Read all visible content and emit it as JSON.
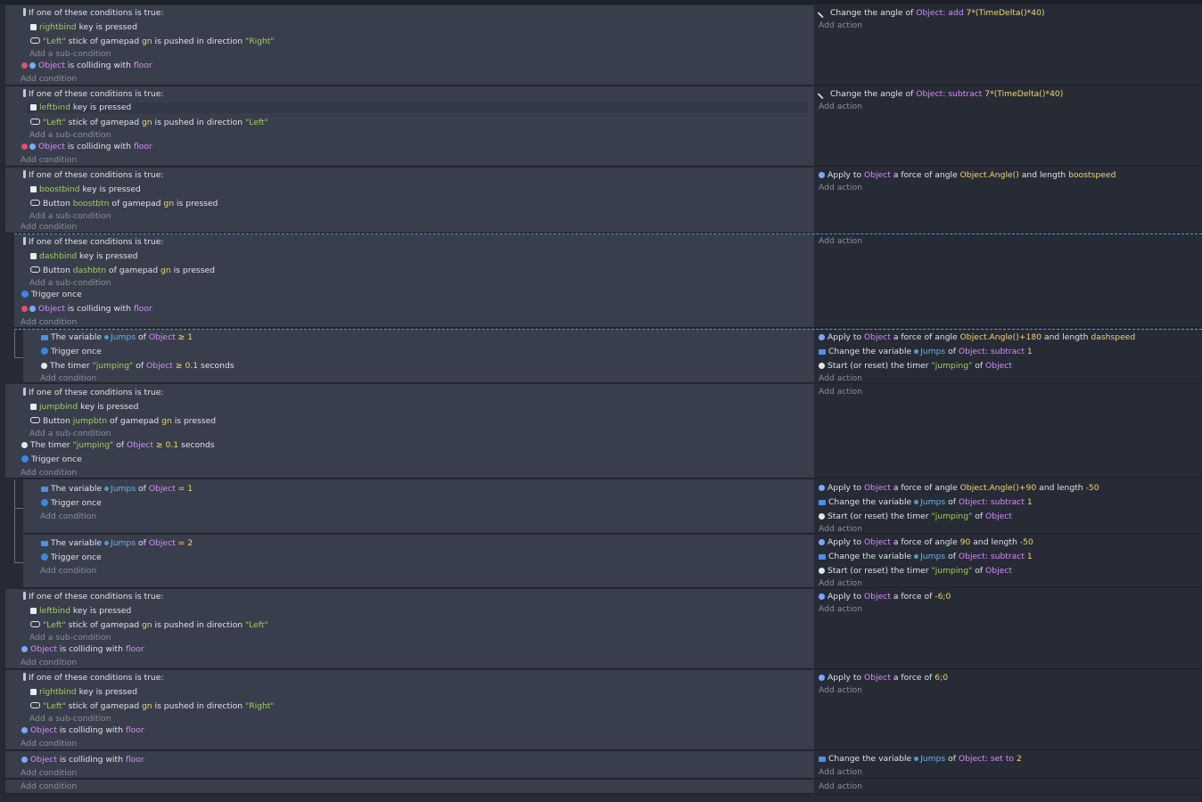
{
  "strings": {
    "if_one": "If one of these conditions is true:",
    "add_condition": "Add condition",
    "add_action": "Add action",
    "add_subcondition": "Add a sub-condition",
    "key_is_pressed": "key is pressed",
    "stick_of_gamepad": "stick of gamepad",
    "is_pushed_in_direction": "is pushed in direction",
    "button": "Button",
    "of_gamepad": "of gamepad",
    "is_pressed": "is pressed",
    "is_colliding_with": "is colliding with",
    "trigger_once": "Trigger once",
    "the_variable": "The variable",
    "of": "of",
    "the_timer": "The timer",
    "seconds": "seconds",
    "change_angle_of": "Change the angle of",
    "apply_to": "Apply to",
    "a_force_of_angle": "a force of angle",
    "and_length": "and length",
    "a_force_of": "a force of",
    "change_the_variable": "Change the variable",
    "start_reset_timer": "Start (or reset) the timer",
    "the_timer_lower": "the timer",
    "ge": "≥",
    "eq": "=",
    "colon_add": ": add",
    "colon_subtract": ": subtract",
    "colon_setto": ": set to"
  },
  "names": {
    "object": "Object",
    "floor": "floor",
    "gn": "gn",
    "jumps": "Jumps",
    "rightbind": "rightbind",
    "leftbind": "leftbind",
    "boostbind": "boostbind",
    "boostbtn": "boostbtn",
    "dashbind": "dashbind",
    "dashbtn": "dashbtn",
    "jumpbind": "jumpbind",
    "jumpbtn": "jumpbtn",
    "left_q": "\"Left\"",
    "right_q": "\"Right\"",
    "jumping_q": "\"jumping\""
  },
  "values": {
    "angle_expr": "7*(TimeDelta()*40)",
    "one": "1",
    "two": "2",
    "zero_one": "0.1",
    "angle": "Object.Angle()",
    "angle_plus180": "Object.Angle()+180",
    "angle_plus90": "Object.Angle()+90",
    "ninety": "90",
    "minus50": "-50",
    "boostspeed": "boostspeed",
    "dashspeed": "dashspeed",
    "force_left": "-6;0",
    "force_right": "6;0"
  },
  "colors": {
    "object_purple": "#d68bfa",
    "value_yellow": "#f2d56b",
    "string_green": "#9ed05a",
    "variable_blue": "#6ab1e8",
    "selection_dashed": "#3da7d6"
  }
}
